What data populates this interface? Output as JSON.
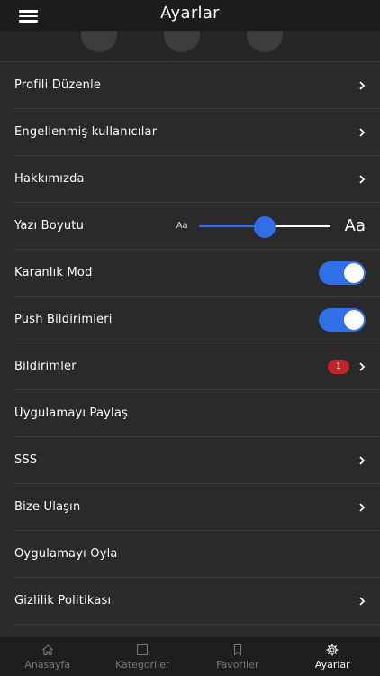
{
  "header": {
    "title": "Ayarlar"
  },
  "settings": {
    "profile": "Profili Düzenle",
    "blocked": "Engellenmiş kullanıcılar",
    "about": "Hakkımızda",
    "font_size": {
      "label": "Yazı Boyutu",
      "small_label": "Aa",
      "large_label": "Aa",
      "value": 0.5
    },
    "dark_mode": {
      "label": "Karanlık Mod",
      "enabled": true
    },
    "push": {
      "label": "Push Bildirimleri",
      "enabled": true
    },
    "notifications": {
      "label": "Bildirimler",
      "badge": "1"
    },
    "share": "Uygulamayı Paylaş",
    "faq": "SSS",
    "contact": "Bize Ulaşın",
    "rate": "Oygulamayı Oyla",
    "privacy": "Gizlilik Politikası"
  },
  "tabs": [
    {
      "label": "Anasayfa",
      "icon": "home-icon"
    },
    {
      "label": "Kategoriler",
      "icon": "square-icon"
    },
    {
      "label": "Favoriler",
      "icon": "bookmark-icon"
    },
    {
      "label": "Ayarlar",
      "icon": "gear-icon",
      "active": true
    }
  ],
  "colors": {
    "accent": "#2f6fe7",
    "badge": "#c0252b",
    "background": "#2a2a2a"
  }
}
